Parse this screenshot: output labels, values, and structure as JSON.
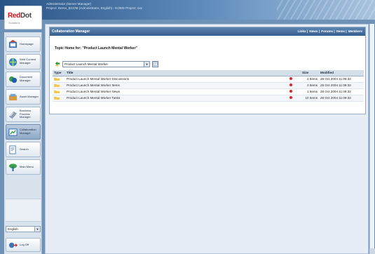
{
  "header": {
    "line1": "Administrator (Server Manager)",
    "line2": "Project: Demo_BCOM (Administrator, English) - KOMS Project: xxx"
  },
  "logo": {
    "red": "Red",
    "dark": "Dot",
    "sub": "Solutions"
  },
  "nav": {
    "items": [
      {
        "label": "Homepage",
        "icon": "home-icon"
      },
      {
        "label": "Web Content Manager",
        "icon": "web-content-icon"
      },
      {
        "label": "Document Manager",
        "icon": "document-icon"
      },
      {
        "label": "Asset Manager",
        "icon": "asset-icon"
      },
      {
        "label": "Business Process Manager",
        "icon": "process-icon"
      },
      {
        "label": "Collaboration Manager",
        "icon": "collaboration-icon"
      },
      {
        "label": "Search",
        "icon": "search-icon"
      },
      {
        "label": "Main Menu",
        "icon": "main-menu-icon"
      }
    ],
    "language": "English",
    "logoff": "Log Off"
  },
  "panel": {
    "title": "Collaboration Manager",
    "tabs": [
      "Links",
      "News",
      "Forums",
      "Items",
      "Members"
    ],
    "topic_title": "Topic Home for: \"Product Launch Mental Worker\"",
    "folder_selected": "Product Launch Mental Worker"
  },
  "table": {
    "headers": {
      "type": "Type",
      "title": "Title",
      "size": "Size",
      "modified": "Modified"
    },
    "rows": [
      {
        "title": "Product Launch Mental Worker Discussions",
        "size": "2 Items",
        "modified": "28 Oct 2004 11:09:32"
      },
      {
        "title": "Product Launch Mental Worker Items",
        "size": "3 Items",
        "modified": "28 Oct 2004 11:09:32"
      },
      {
        "title": "Product Launch Mental Worker News",
        "size": "1 Items",
        "modified": "28 Oct 2004 11:09:32"
      },
      {
        "title": "Product Launch Mental Worker Tasks",
        "size": "10 Items",
        "modified": "28 Oct 2004 11:09:32"
      }
    ]
  },
  "colors": {
    "header_dark": "#2a5485",
    "panel_head": "#355f8d",
    "alert": "#e02424",
    "folder": "#f2c94c"
  }
}
